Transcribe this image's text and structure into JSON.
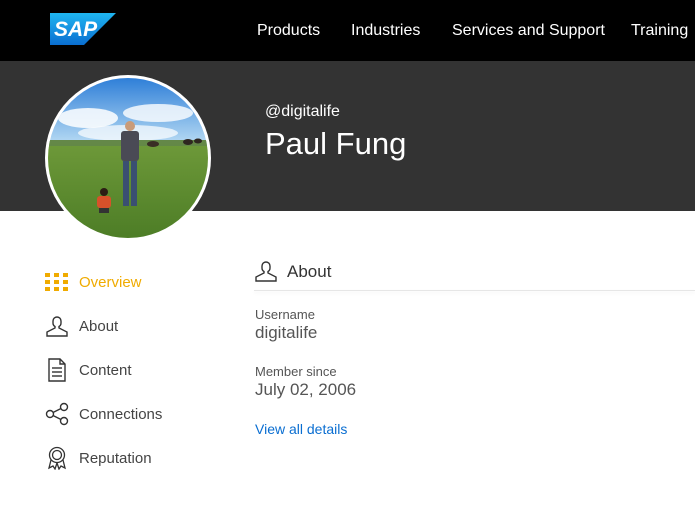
{
  "header": {
    "logo_text": "SAP",
    "logo_color": "#0a6ed1",
    "nav": [
      "Products",
      "Industries",
      "Services and Support",
      "Training"
    ]
  },
  "profile": {
    "handle": "@digitalife",
    "name": "Paul Fung"
  },
  "sidebar": {
    "items": [
      {
        "label": "Overview",
        "icon": "grid-icon",
        "active": true
      },
      {
        "label": "About",
        "icon": "person-icon"
      },
      {
        "label": "Content",
        "icon": "document-icon"
      },
      {
        "label": "Connections",
        "icon": "share-network-icon"
      },
      {
        "label": "Reputation",
        "icon": "award-badge-icon"
      }
    ]
  },
  "about": {
    "title": "About",
    "username_label": "Username",
    "username": "digitalife",
    "member_since_label": "Member since",
    "member_since": "July 02, 2006",
    "view_all_link": "View all details"
  },
  "colors": {
    "topbar": "#000000",
    "hero": "#333333",
    "accent": "#f0ab00",
    "link": "#0a6ed1"
  }
}
